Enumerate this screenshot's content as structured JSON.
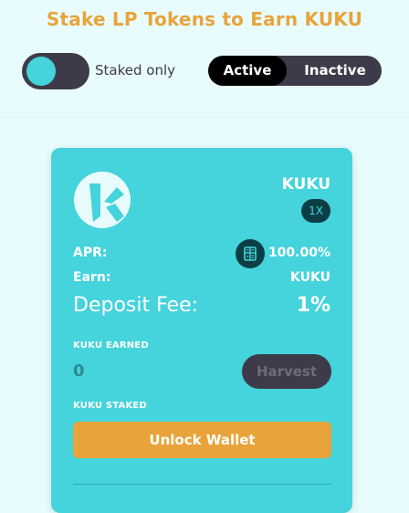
{
  "page": {
    "title": "Stake LP Tokens to Earn KUKU"
  },
  "filters": {
    "staked_only_label": "Staked only",
    "staked_only_on": true,
    "tabs": [
      {
        "label": "Active",
        "selected": true
      },
      {
        "label": "Inactive",
        "selected": false
      }
    ]
  },
  "farm_card": {
    "logo_icon": "kuku-logo-icon",
    "token": "KUKU",
    "multiplier": "1X",
    "apr_label": "APR:",
    "apr_value": "100.00%",
    "calculator_icon": "calculator-icon",
    "earn_label": "Earn:",
    "earn_value": "KUKU",
    "deposit_fee_label": "Deposit Fee:",
    "deposit_fee_value": "1%",
    "earned_caption": "KUKU EARNED",
    "earned_amount": "0",
    "harvest_label": "Harvest",
    "staked_caption": "KUKU STAKED",
    "unlock_label": "Unlock Wallet"
  },
  "colors": {
    "accent_orange": "#e8a43a",
    "card_teal": "#45d3dc",
    "dark": "#3d3b4a"
  }
}
